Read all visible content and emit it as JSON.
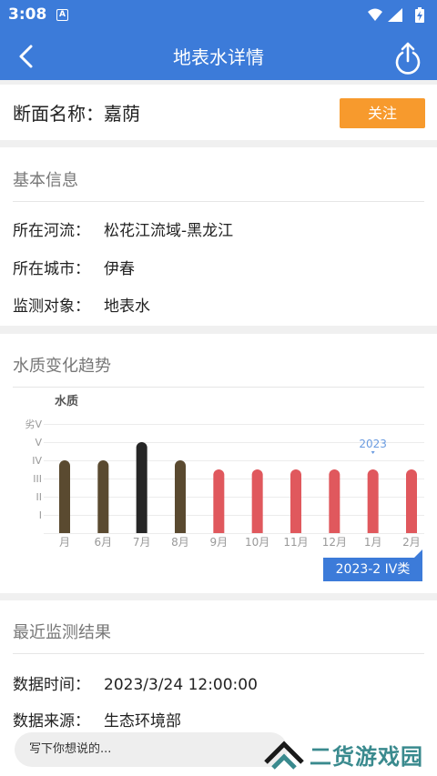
{
  "status": {
    "time": "3:08",
    "app_icon_letter": "A"
  },
  "header": {
    "title": "地表水详情",
    "back_icon": "chevron-left-icon",
    "share_icon": "share-upload-icon"
  },
  "section": {
    "name": "断面名称：嘉荫",
    "follow_label": "关注"
  },
  "basic_info": {
    "title": "基本信息",
    "rows": [
      {
        "label": "所在河流：",
        "value": "松花江流域-黑龙江"
      },
      {
        "label": "所在城市：",
        "value": "伊春"
      },
      {
        "label": "监测对象：",
        "value": "地表水"
      }
    ]
  },
  "trend": {
    "title": "水质变化趋势",
    "tag": "2023-2 IV类"
  },
  "chart_data": {
    "type": "bar",
    "title": "水质",
    "y_categories": [
      "I",
      "II",
      "III",
      "IV",
      "V",
      "劣V"
    ],
    "categories": [
      "月",
      "6月",
      "7月",
      "8月",
      "9月",
      "10月",
      "11月",
      "12月",
      "1月",
      "2月"
    ],
    "values": [
      4,
      4,
      5,
      4,
      3.5,
      3.5,
      3.5,
      3.5,
      3.5,
      3.5
    ],
    "bar_colors": [
      "#5a4a30",
      "#5a4a30",
      "#262626",
      "#5a4a30",
      "#e0585d",
      "#e0585d",
      "#e0585d",
      "#e0585d",
      "#e0585d",
      "#e0585d"
    ],
    "year_marker": {
      "label": "2023",
      "category": "1月"
    },
    "ylim": [
      0,
      6
    ],
    "grid": true
  },
  "recent": {
    "title": "最近监测结果",
    "rows": [
      {
        "label": "数据时间：",
        "value": "2023/3/24 12:00:00"
      },
      {
        "label": "数据来源：",
        "value": "生态环境部"
      }
    ]
  },
  "comment": {
    "placeholder": "写下你想说的..."
  },
  "watermark": {
    "text": "二货游戏园"
  }
}
